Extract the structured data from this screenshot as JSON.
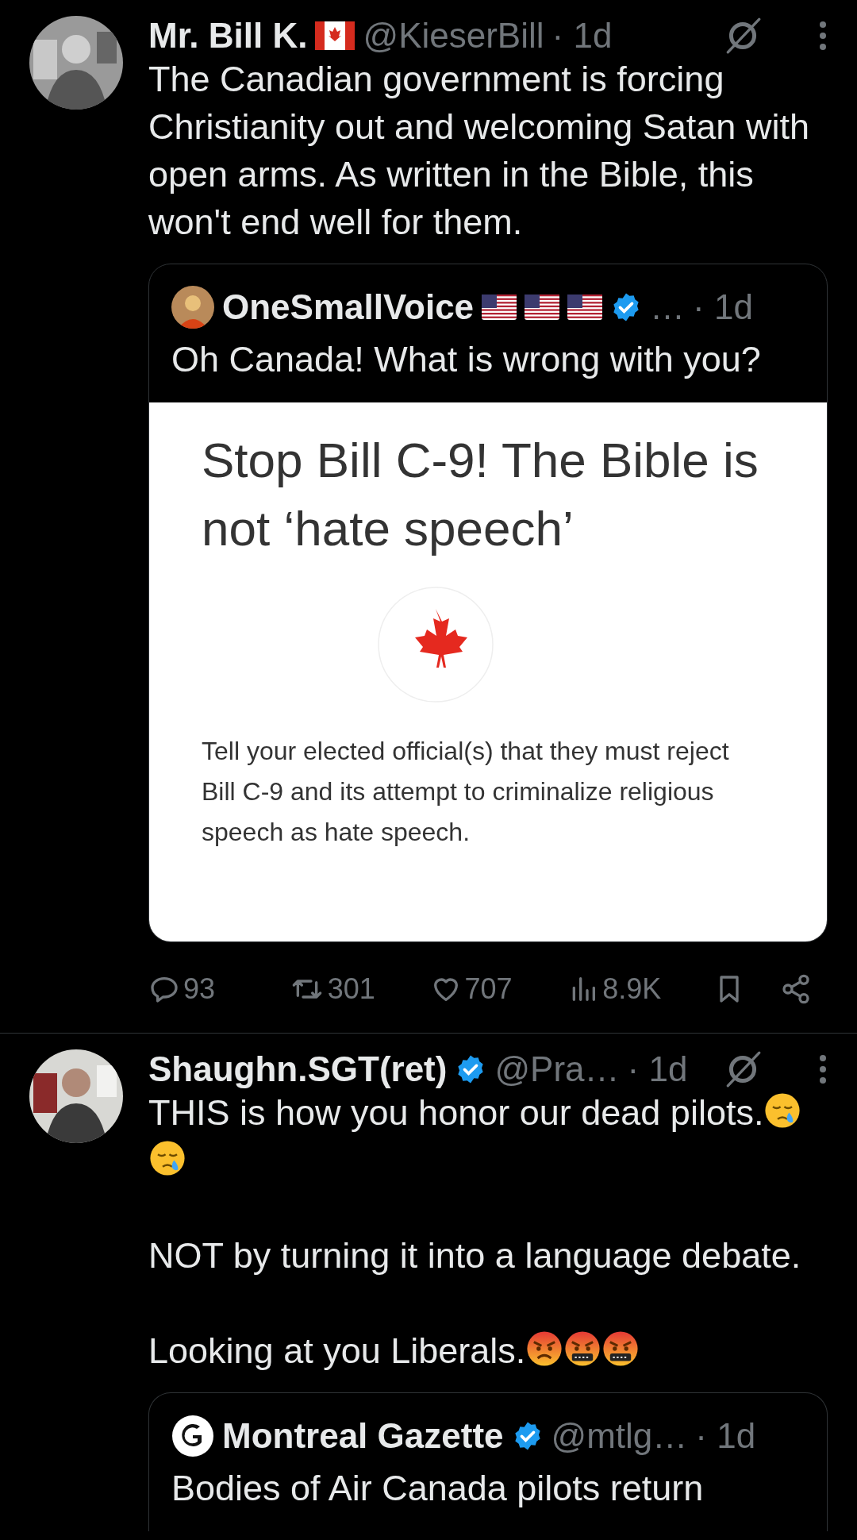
{
  "tweets": [
    {
      "author": {
        "name": "Mr. Bill K.",
        "badges": [
          {
            "kind": "canada-flag"
          }
        ],
        "verified": false,
        "handle": "@KieserBill",
        "time": "· 1d"
      },
      "paragraphs": [
        {
          "text": "The Canadian government is forcing Christianity out and welcoming Satan with open arms. As written in the Bible, this won't end well for them."
        }
      ],
      "quote": {
        "author": {
          "name": "OneSmallVoice",
          "avatar": {
            "kind": "photo"
          },
          "badges": [
            {
              "kind": "us-flag"
            },
            {
              "kind": "us-flag"
            },
            {
              "kind": "us-flag"
            }
          ],
          "verified": true,
          "handle": "…",
          "time": "· 1d"
        },
        "text": "Oh Canada! What is wrong with you?",
        "media": {
          "kind": "document",
          "headline": "Stop Bill C-9! The Bible is not ‘hate speech’",
          "body": "Tell your elected official(s) that they must reject Bill C-9 and its attempt to criminalize religious speech as hate speech."
        }
      },
      "actions": [
        {
          "kind": "reply",
          "count": "93"
        },
        {
          "kind": "repost",
          "count": "301"
        },
        {
          "kind": "like",
          "count": "707"
        },
        {
          "kind": "views",
          "count": "8.9K"
        },
        {
          "kind": "bookmark"
        },
        {
          "kind": "share"
        }
      ]
    },
    {
      "author": {
        "name": "Shaughn.SGT(ret)",
        "verified": true,
        "handle": "@Pra…",
        "time": "· 1d"
      },
      "paragraphs": [
        {
          "text": "THIS is how you honor our dead pilots.",
          "emojis": [
            {
              "kind": "crying"
            },
            {
              "kind": "crying"
            }
          ]
        },
        {
          "text": "NOT by turning it into a language debate."
        },
        {
          "text": "Looking at you Liberals.",
          "emojis": [
            {
              "kind": "angry"
            },
            {
              "kind": "cursing"
            },
            {
              "kind": "cursing"
            }
          ]
        }
      ],
      "quote": {
        "author": {
          "name": "Montreal Gazette",
          "avatar": {
            "kind": "logo"
          },
          "verified": true,
          "handle": "@mtlg…",
          "time": "· 1d"
        },
        "text": "Bodies of Air Canada pilots return"
      }
    }
  ]
}
